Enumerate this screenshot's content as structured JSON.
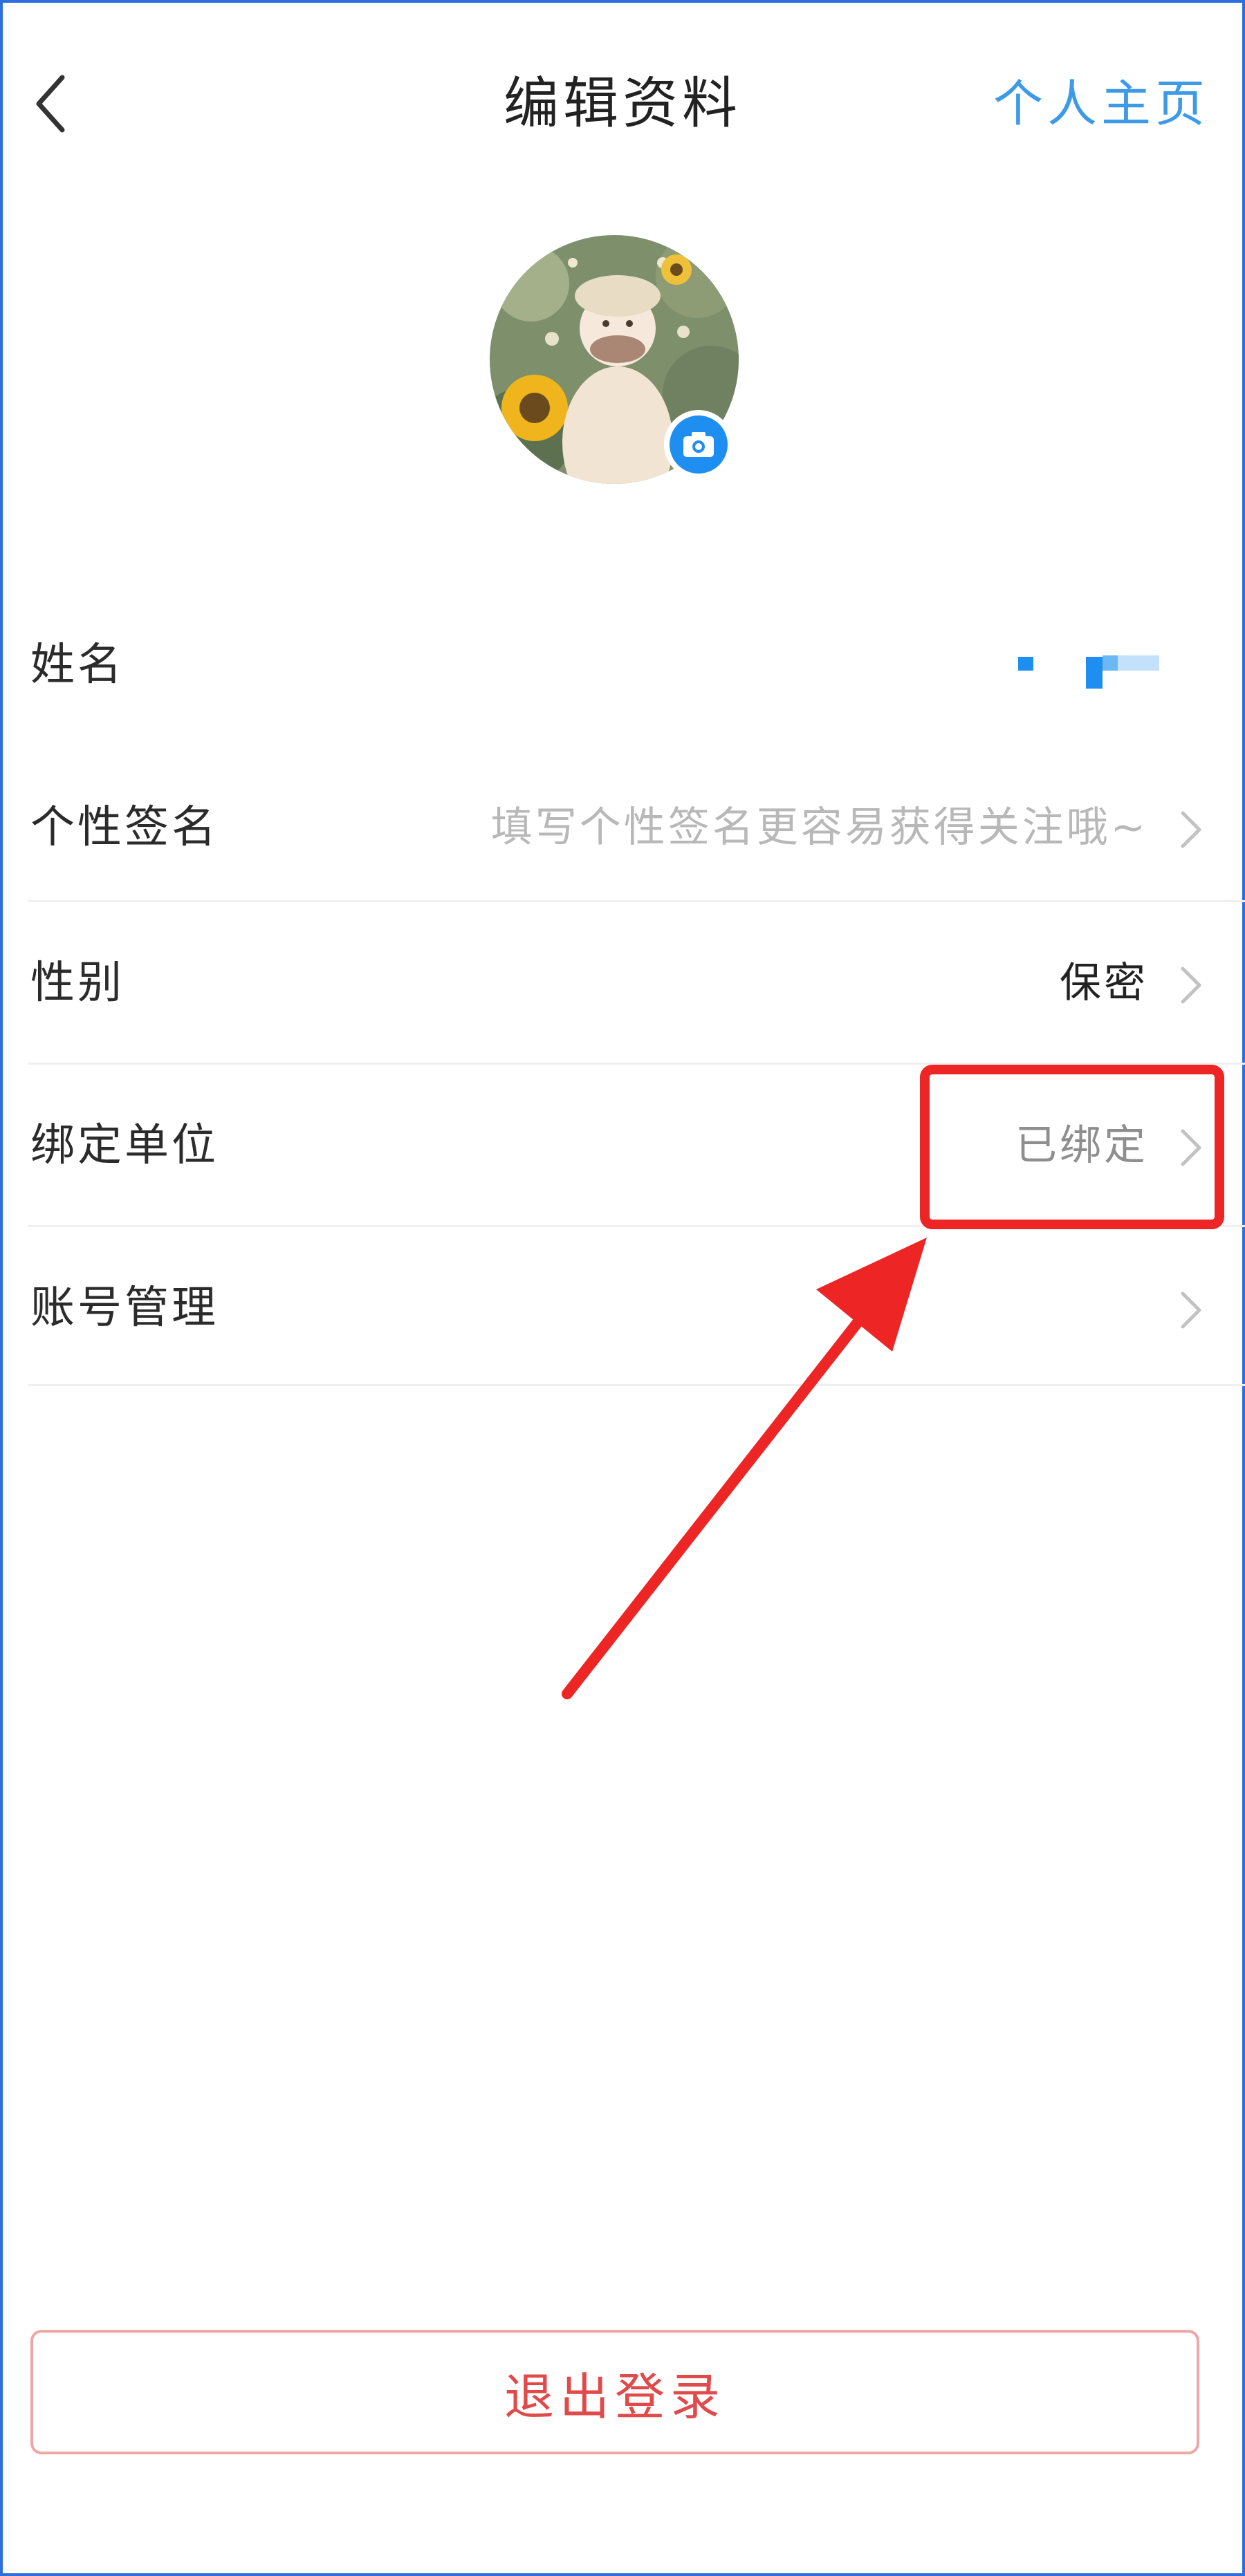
{
  "header": {
    "title": "编辑资料",
    "right_link": "个人主页"
  },
  "rows": [
    {
      "label": "姓名",
      "value": ""
    },
    {
      "label": "个性签名",
      "value": "填写个性签名更容易获得关注哦~"
    },
    {
      "label": "性别",
      "value": "保密"
    },
    {
      "label": "绑定单位",
      "value": "已绑定"
    },
    {
      "label": "账号管理",
      "value": ""
    }
  ],
  "footer": {
    "logout_label": "退出登录"
  },
  "colors": {
    "accent_blue": "#3c9ae6",
    "annotation_red": "#ee2525",
    "logout_red": "#e04a4a"
  },
  "icons": [
    "back-arrow-icon",
    "camera-icon",
    "chevron-right-icon"
  ]
}
